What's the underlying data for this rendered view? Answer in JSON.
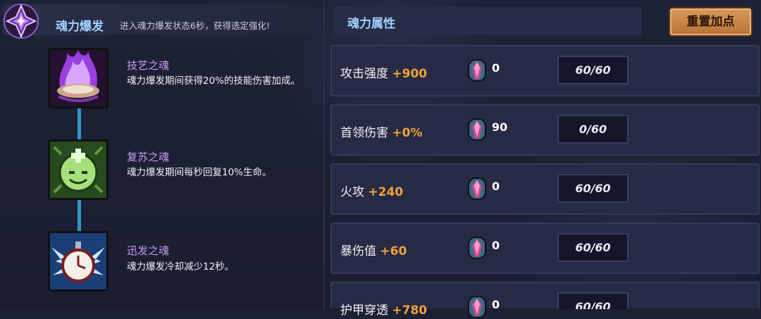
{
  "burst": {
    "title": "魂力爆发",
    "description": "进入魂力爆发状态6秒，获得选定强化!"
  },
  "skills": [
    {
      "name": "技艺之魂",
      "desc": "魂力爆发期间获得20%的技能伤害加成。",
      "icon": "purple-flame-icon"
    },
    {
      "name": "复苏之魂",
      "desc": "魂力爆发期间每秒回复10%生命。",
      "icon": "green-heal-spirit-icon"
    },
    {
      "name": "迅发之魂",
      "desc": "魂力爆发冷却减少12秒。",
      "icon": "winged-clock-icon"
    }
  ],
  "attributes": {
    "title": "魂力属性",
    "reset_label": "重置加点",
    "rows": [
      {
        "name": "攻击强度",
        "bonus": "+900",
        "gems": "0",
        "progress": "60/60"
      },
      {
        "name": "首领伤害",
        "bonus": "+0%",
        "gems": "90",
        "progress": "0/60"
      },
      {
        "name": "火攻",
        "bonus": "+240",
        "gems": "0",
        "progress": "60/60"
      },
      {
        "name": "暴伤值",
        "bonus": "+60",
        "gems": "0",
        "progress": "60/60"
      },
      {
        "name": "护甲穿透",
        "bonus": "+780",
        "gems": "0",
        "progress": "60/60"
      }
    ]
  },
  "colors": {
    "accent_blue": "#9fd2ff",
    "bonus_orange": "#f0a23a",
    "skill_name_purple": "#c39bf0",
    "button_orange": "#d89a58"
  }
}
